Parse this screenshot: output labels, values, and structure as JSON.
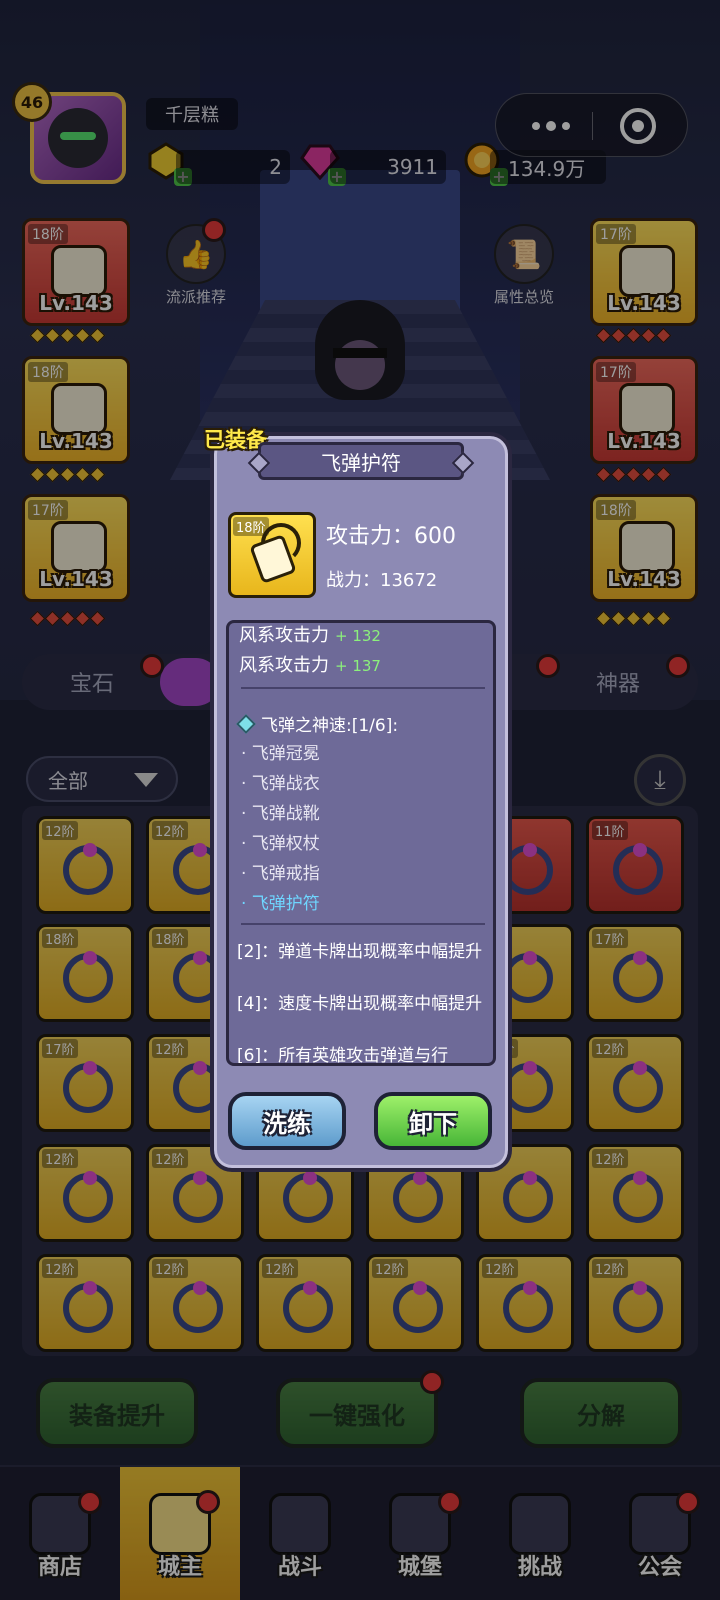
{
  "player": {
    "level": "46",
    "name": "千层糕"
  },
  "resources": [
    {
      "name": "gold-bar",
      "value": "2"
    },
    {
      "name": "gem",
      "value": "3911"
    },
    {
      "name": "coin",
      "value": "134.9万"
    }
  ],
  "side_buttons": {
    "recommend": "流派推荐",
    "attributes": "属性总览"
  },
  "slots_left": [
    {
      "tier": "18阶",
      "level": "Lv.143",
      "color": "red"
    },
    {
      "tier": "18阶",
      "level": "Lv.143",
      "color": "red"
    },
    {
      "tier": "17阶",
      "level": "Lv.143",
      "color": "yellow"
    }
  ],
  "slots_right": [
    {
      "tier": "17阶",
      "level": "Lv.143",
      "color": "yellow"
    },
    {
      "tier": "17阶",
      "level": "Lv.143",
      "color": "red"
    },
    {
      "tier": "18阶",
      "level": "Lv.143",
      "color": "yellow"
    }
  ],
  "tabs": {
    "gem": "宝石",
    "artifact": "神器"
  },
  "filter": {
    "label": "全部"
  },
  "inventory_rows": [
    [
      "12阶",
      "12阶",
      "",
      "",
      "",
      "11阶"
    ],
    [
      "18阶",
      "18阶",
      "",
      "",
      "",
      "17阶"
    ],
    [
      "17阶",
      "12阶",
      "",
      "",
      "12阶",
      "12阶"
    ],
    [
      "12阶",
      "12阶",
      "",
      "",
      "",
      "12阶"
    ],
    [
      "12阶",
      "12阶",
      "12阶",
      "12阶",
      "12阶",
      "12阶"
    ]
  ],
  "actions": {
    "upgrade": "装备提升",
    "enhance": "一键强化",
    "decompose": "分解"
  },
  "nav": [
    "商店",
    "城主",
    "战斗",
    "城堡",
    "挑战",
    "公会"
  ],
  "modal": {
    "tag": "已装备",
    "title": "飞弹护符",
    "item_tier": "18阶",
    "attack_label": "攻击力：600",
    "power_label": "战力：13672",
    "stats": [
      {
        "label": "风系攻击力",
        "value": "+ 132"
      },
      {
        "label": "风系攻击力",
        "value": "+ 137"
      }
    ],
    "set_title": "飞弹之神速:[1/6]:",
    "set_items": [
      "· 飞弹冠冕",
      "· 飞弹战衣",
      "· 飞弹战靴",
      "· 飞弹权杖",
      "· 飞弹戒指",
      "· 飞弹护符"
    ],
    "bonuses": [
      "[2]：弹道卡牌出现概率中幅提升",
      "[4]：速度卡牌出现概率中幅提升",
      "[6]：所有英雄攻击弹道与行"
    ],
    "refine_button": "洗练",
    "unequip_button": "卸下"
  },
  "colors": {
    "accent_green": "#8cf07c",
    "set_current": "#6fd6ff",
    "tag_yellow": "#ffe94a"
  }
}
